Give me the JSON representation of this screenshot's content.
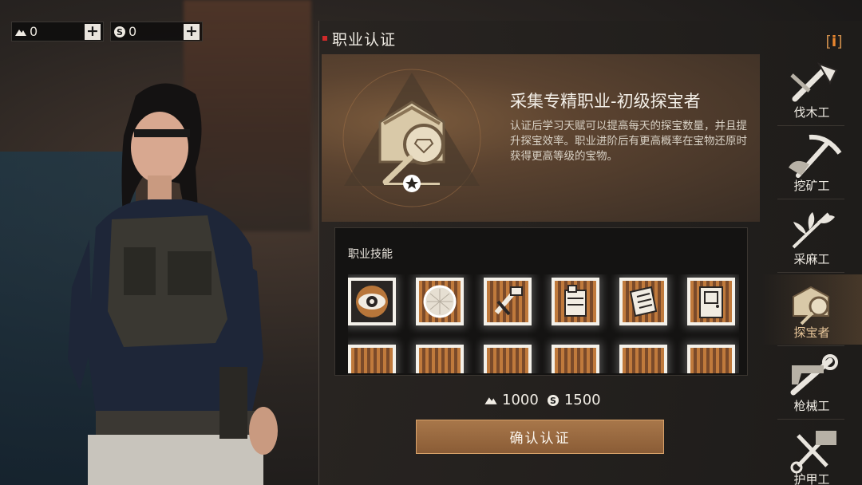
{
  "currencies": [
    {
      "icon": "mountain-coin-icon",
      "value": "0"
    },
    {
      "icon": "silver-coin-icon",
      "value": "0"
    }
  ],
  "panel": {
    "title": "职业认证",
    "info_label": "i"
  },
  "job_detail": {
    "title": "采集专精职业-初级探宝者",
    "description": "认证后学习天赋可以提高每天的探宝数量，并且提升探宝效率。职业进阶后有更高概率在宝物还原时获得更高等级的宝物。",
    "level_stars": 1
  },
  "skills": {
    "title": "职业技能",
    "icons": [
      "eye-icon",
      "radar-icon",
      "pickaxe-tool-icon",
      "jerrycan-icon",
      "blueprint-icon",
      "door-icon",
      "skill-icon",
      "skill-icon",
      "skill-icon",
      "skill-icon",
      "skill-icon",
      "skill-icon"
    ]
  },
  "cost": {
    "primary_icon": "mountain-coin-icon",
    "primary_value": "1000",
    "secondary_icon": "silver-coin-icon",
    "secondary_value": "1500"
  },
  "confirm_label": "确认认证",
  "jobs": [
    {
      "label": "伐木工",
      "icon": "axe-icon",
      "active": false
    },
    {
      "label": "挖矿工",
      "icon": "pickaxe-icon",
      "active": false
    },
    {
      "label": "采麻工",
      "icon": "hemp-icon",
      "active": false
    },
    {
      "label": "探宝者",
      "icon": "treasure-icon",
      "active": true
    },
    {
      "label": "枪械工",
      "icon": "wrench-gun-icon",
      "active": false
    },
    {
      "label": "护甲工",
      "icon": "scissors-icon",
      "active": false
    }
  ],
  "colors": {
    "accent": "#e8862e",
    "confirm": "#9a6a40",
    "marker": "#d12a2a"
  }
}
